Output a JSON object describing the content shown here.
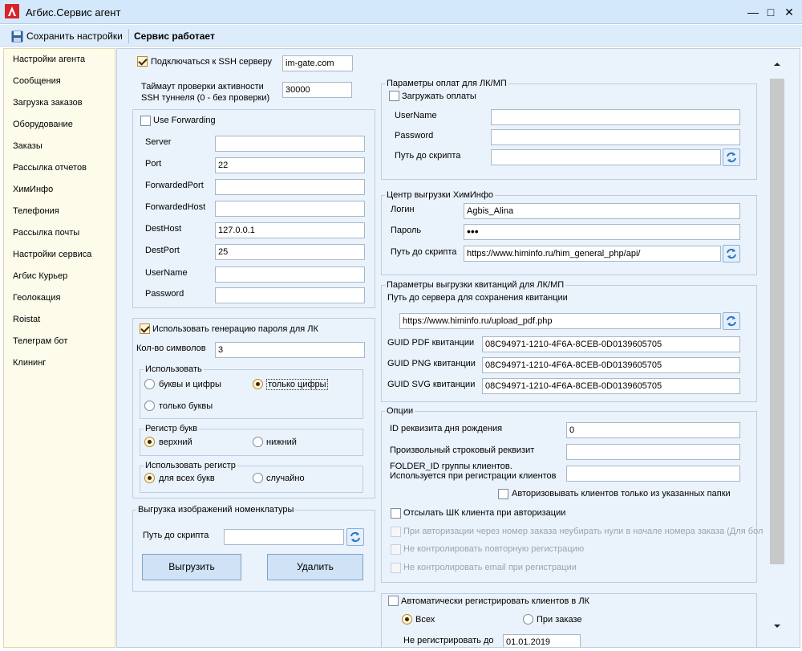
{
  "window": {
    "title": "Агбис.Сервис агент",
    "minimize": "—",
    "maximize": "□",
    "close": "✕"
  },
  "toolbar": {
    "save_label": "Сохранить настройки",
    "status": "Сервис работает"
  },
  "sidebar": {
    "items": [
      "Настройки агента",
      "Сообщения",
      "Загрузка заказов",
      "Оборудование",
      "Заказы",
      "Рассылка отчетов",
      "ХимИнфо",
      "Телефония",
      "Рассылка почты",
      "Настройки сервиса",
      "Агбис Курьер",
      "Геолокация",
      "Roistat",
      "Телеграм бот",
      "Клининг"
    ]
  },
  "ssh": {
    "connect_label": "Подключаться к SSH серверу",
    "connect_checked": true,
    "host": "im-gate.com",
    "timeout_label_1": "Таймаут проверки активности",
    "timeout_label_2": "SSH туннеля (0 - без проверки)",
    "timeout_value": "30000",
    "forwarding": {
      "label": "Use Forwarding",
      "checked": false,
      "server_label": "Server",
      "server_value": "",
      "port_label": "Port",
      "port_value": "22",
      "fport_label": "ForwardedPort",
      "fport_value": "",
      "fhost_label": "ForwardedHost",
      "fhost_value": "",
      "dhost_label": "DestHost",
      "dhost_value": "127.0.0.1",
      "dport_label": "DestPort",
      "dport_value": "25",
      "user_label": "UserName",
      "user_value": "",
      "pass_label": "Password",
      "pass_value": ""
    }
  },
  "password_gen": {
    "label": "Использовать генерацию пароля для ЛК",
    "checked": true,
    "count_label": "Кол-во символов",
    "count_value": "3",
    "use_title": "Использовать",
    "opt_letters_digits": "буквы и цифры",
    "opt_digits_only": "только цифры",
    "opt_letters_only": "только буквы",
    "case_title": "Регистр букв",
    "case_upper": "верхний",
    "case_lower": "нижний",
    "apply_title": "Использовать регистр",
    "apply_all": "для всех букв",
    "apply_random": "случайно"
  },
  "export_images": {
    "title": "Выгрузка изображений номенклатуры",
    "script_label": "Путь до скрипта",
    "script_value": "",
    "upload_button": "Выгрузить",
    "delete_button": "Удалить"
  },
  "payments": {
    "title": "Параметры оплат для ЛК/МП",
    "load_label": "Загружать оплаты",
    "load_checked": false,
    "user_label": "UserName",
    "user_value": "",
    "pass_label": "Password",
    "pass_value": "",
    "script_label": "Путь до скрипта",
    "script_value": ""
  },
  "himinfo": {
    "title": "Центр выгрузки ХимИнфо",
    "login_label": "Логин",
    "login_value": "Agbis_Alina",
    "pass_label": "Пароль",
    "pass_value": "•••",
    "script_label": "Путь до скрипта",
    "script_value": "https://www.himinfo.ru/him_general_php/api/"
  },
  "receipts": {
    "title": "Параметры выгрузки квитанций для ЛК/МП",
    "server_path_label": "Путь до сервера для сохранения квитанции",
    "server_path_value": "https://www.himinfo.ru/upload_pdf.php",
    "pdf_label": "GUID PDF квитанции",
    "pdf_value": "08C94971-1210-4F6A-8CEB-0D0139605705",
    "png_label": "GUID PNG квитанции",
    "png_value": "08C94971-1210-4F6A-8CEB-0D0139605705",
    "svg_label": "GUID SVG квитанции",
    "svg_value": "08C94971-1210-4F6A-8CEB-0D0139605705"
  },
  "options": {
    "title": "Опции",
    "birthday_label": "ID реквизита дня рождения",
    "birthday_value": "0",
    "custom_label": "Произвольный строковый реквизит",
    "custom_value": "",
    "folder_label_1": "FOLDER_ID группы клиентов.",
    "folder_label_2": "Используется при регистрации клиентов",
    "folder_value": "",
    "auth_folder_label": "Авторизовывать клиентов только из указанных папки",
    "send_barcode_label": "Отсылать ШК клиента при авторизации",
    "no_zero_label": "При авторизации через номер заказа неубирать нули в начале номера заказа (Для бол",
    "no_repeat_label": "Не контролировать повторную регистрацию",
    "no_email_label": "Не контролировать email при регистрации"
  },
  "autoreg": {
    "label": "Автоматически регистрировать клиентов в ЛК",
    "all_label": "Всех",
    "order_label": "При заказе",
    "partial_label": "Не регистрировать до",
    "partial_value": "01.01.2019"
  },
  "colors": {
    "titlebar": "#d4e8fb",
    "sidebar": "#fdfbea",
    "content": "#eaf2fb",
    "accent": "#d9232a"
  }
}
